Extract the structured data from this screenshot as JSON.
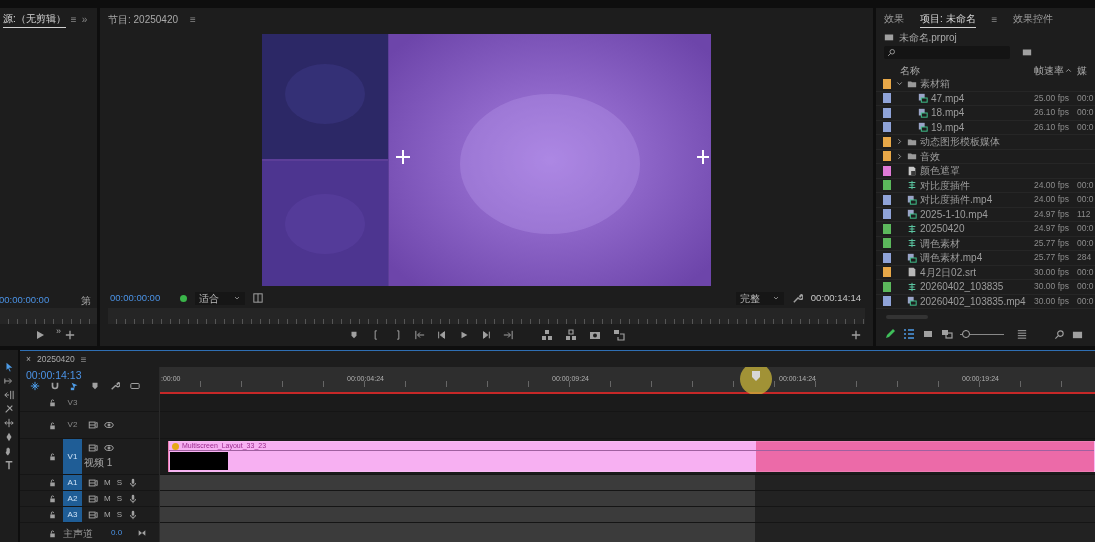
{
  "source_panel": {
    "tab": "源:（无剪辑）",
    "menu": "≡",
    "overflow": "»",
    "timecode": "00:00:00:00",
    "label": "第",
    "more": "»"
  },
  "program_panel": {
    "title": "节目: 20250420",
    "menu": "≡",
    "timecode": "00:00:00:00",
    "fit": "适合",
    "quality": "完整",
    "duration": "00:00:14:14"
  },
  "project_panel": {
    "zoom": {
      "level": 0.05
    },
    "tabs": [
      {
        "label": "效果",
        "selected": false
      },
      {
        "label": "项目: 未命名",
        "selected": true
      },
      {
        "label": "效果控件",
        "selected": false
      }
    ],
    "menu": "≡",
    "file": "未命名.prproj",
    "columns": [
      "名称",
      "帧速率",
      "媒"
    ],
    "items": [
      {
        "kind": "folder",
        "name": "素材箱",
        "color": "#e8a848",
        "expanded": true,
        "children": [
          {
            "kind": "clip",
            "name": "47.mp4",
            "color": "#8fa3d8",
            "fps": "25.00 fps",
            "media": "00:0"
          },
          {
            "kind": "clip",
            "name": "18.mp4",
            "color": "#8fa3d8",
            "fps": "26.10 fps",
            "media": "00:0"
          },
          {
            "kind": "clip",
            "name": "19.mp4",
            "color": "#8fa3d8",
            "fps": "26.10 fps",
            "media": "00:0"
          }
        ]
      },
      {
        "kind": "folder",
        "name": "动态图形模板媒体",
        "color": "#e8a848",
        "expanded": false
      },
      {
        "kind": "folder",
        "name": "音效",
        "color": "#e8a848",
        "expanded": false
      },
      {
        "kind": "matte",
        "name": "颜色遮罩",
        "color": "#e07ad8"
      },
      {
        "kind": "sequence",
        "name": "对比度插件",
        "color": "#5cb85c",
        "fps": "24.00 fps",
        "media": "00:0"
      },
      {
        "kind": "clip",
        "name": "对比度插件.mp4",
        "color": "#8fa3d8",
        "fps": "24.00 fps",
        "media": "00:0"
      },
      {
        "kind": "clip",
        "name": "2025-1-10.mp4",
        "color": "#8fa3d8",
        "fps": "24.97 fps",
        "media": "112"
      },
      {
        "kind": "sequence",
        "name": "20250420",
        "color": "#5cb85c",
        "fps": "24.97 fps",
        "media": "00:0"
      },
      {
        "kind": "sequence",
        "name": "调色素材",
        "color": "#5cb85c",
        "fps": "25.77 fps",
        "media": "00:0"
      },
      {
        "kind": "clip",
        "name": "调色素材.mp4",
        "color": "#8fa3d8",
        "fps": "25.77 fps",
        "media": "284"
      },
      {
        "kind": "file",
        "name": "4月2日02.srt",
        "color": "#e8a848",
        "fps": "30.00 fps",
        "media": "00:0"
      },
      {
        "kind": "sequence",
        "name": "20260402_103835",
        "color": "#5cb85c",
        "fps": "30.00 fps",
        "media": "00:0"
      },
      {
        "kind": "clip",
        "name": "20260402_103835.mp4",
        "color": "#8fa3d8",
        "fps": "30.00 fps",
        "media": "00:0"
      }
    ]
  },
  "timeline": {
    "close": "×",
    "title": "20250420",
    "menu": "≡",
    "timecode": "00:00:14:13",
    "ruler": [
      ":00:00",
      "00:00:04:24",
      "00:00:09:24",
      "00:00:14:24",
      "00:00:19:24"
    ],
    "tracks": [
      {
        "kind": "video",
        "label": "V3",
        "selected": false
      },
      {
        "kind": "video",
        "label": "V2",
        "selected": false
      },
      {
        "kind": "video",
        "label": "V1",
        "name": "视频 1",
        "selected": true,
        "clip": {
          "name": "Multiscreen_Layout_33_23",
          "color": "#f7b0f2"
        }
      },
      {
        "kind": "audio",
        "label": "A1",
        "selected": true,
        "mute": "M",
        "solo": "S"
      },
      {
        "kind": "audio",
        "label": "A2",
        "selected": true,
        "mute": "M",
        "solo": "S"
      },
      {
        "kind": "audio",
        "label": "A3",
        "selected": true,
        "mute": "M",
        "solo": "S"
      },
      {
        "kind": "master",
        "label": "主声道",
        "value": "0.0"
      }
    ]
  }
}
